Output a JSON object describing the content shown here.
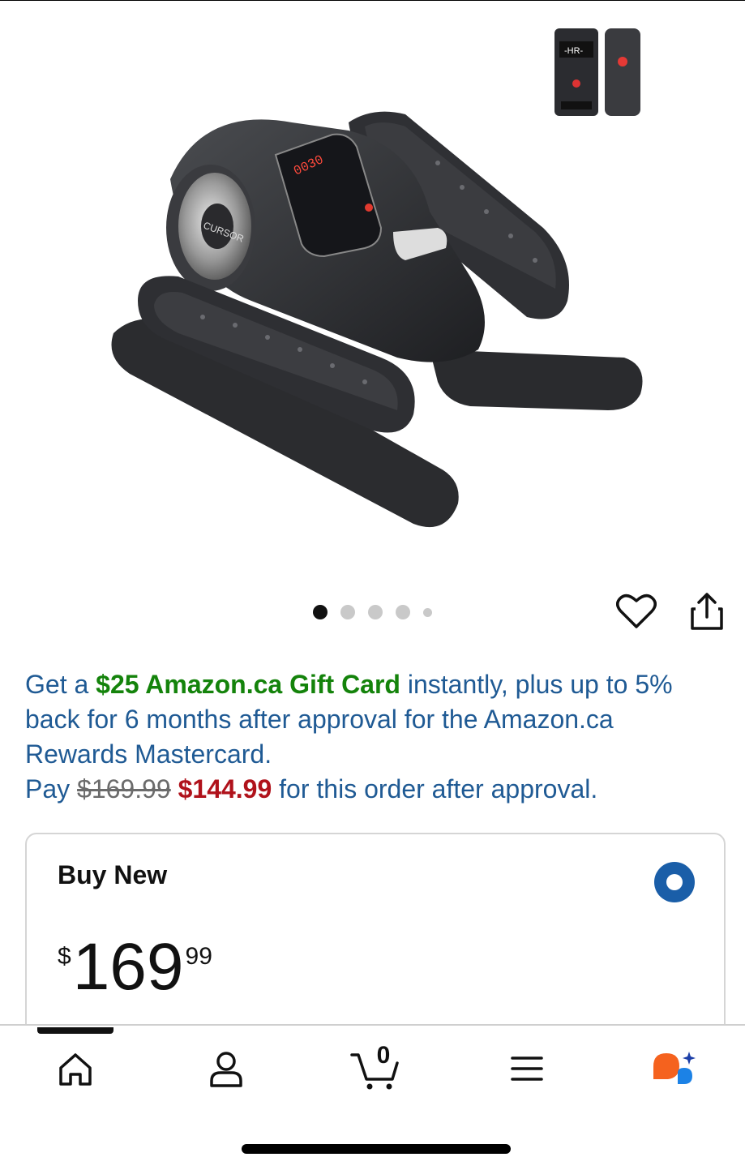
{
  "product": {
    "brand_logo": "CURSOR",
    "display_text": "0030",
    "remote_label": "-HR-"
  },
  "carousel": {
    "total_images": 5,
    "active_index": 0
  },
  "icons": {
    "wishlist": "heart-icon",
    "share": "share-icon"
  },
  "promo": {
    "line_prefix": "Get a ",
    "gift_card": "$25 Amazon.ca Gift Card",
    "line_rest": " instantly, plus up to 5% back for 6 months after approval for the Amazon.ca Rewards Mastercard.",
    "pay_prefix": "Pay ",
    "original_price": "$169.99",
    "discount_price": "$144.99",
    "pay_suffix": " for this order after approval."
  },
  "buy_box": {
    "title": "Buy New",
    "price_symbol": "$",
    "price_whole": "169",
    "price_fraction": "99",
    "selected": true
  },
  "bottom_nav": {
    "items": [
      "home-icon",
      "account-icon",
      "cart-icon",
      "menu-icon",
      "rufus-icon"
    ],
    "cart_count": "0",
    "active": "home"
  },
  "colors": {
    "promo_text": "#1f5a94",
    "gift_card_green": "#14830b",
    "discount_red": "#b0121b",
    "radio_blue": "#1a5ea8"
  }
}
